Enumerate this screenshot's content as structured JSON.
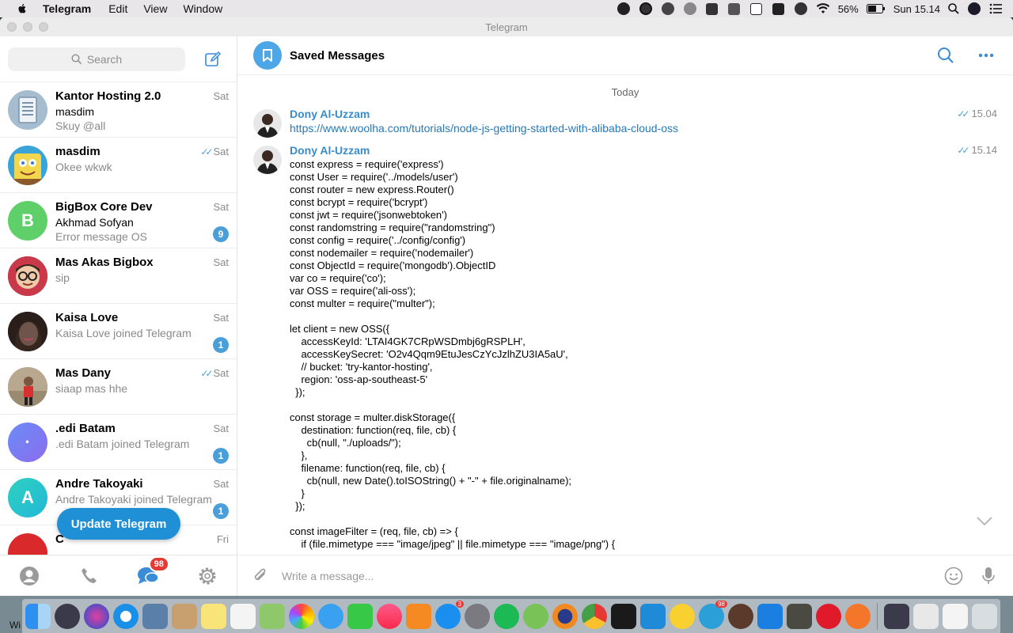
{
  "menubar": {
    "app": "Telegram",
    "items": [
      "Edit",
      "View",
      "Window"
    ],
    "battery": "56%",
    "clock": "Sun 15.14"
  },
  "window": {
    "title": "Telegram"
  },
  "sidebar": {
    "search_placeholder": "Search",
    "chats": [
      {
        "name": "Kantor Hosting 2.0",
        "line2": "masdim",
        "line3": "Skuy @all",
        "time": "Sat",
        "read": false,
        "badge": "",
        "avatar_color": "#9fb9cf",
        "initial": ""
      },
      {
        "name": "masdim",
        "line2": "Okee wkwk",
        "line3": "",
        "time": "Sat",
        "read": true,
        "badge": "",
        "avatar_color": "#f2c94c",
        "initial": ""
      },
      {
        "name": "BigBox Core Dev",
        "line2": "Akhmad Sofyan",
        "line3": "Error message OS",
        "time": "Sat",
        "read": false,
        "badge": "9",
        "avatar_color": "#5fcf6a",
        "initial": "B"
      },
      {
        "name": "Mas Akas Bigbox",
        "line2": "sip",
        "line3": "",
        "time": "Sat",
        "read": false,
        "badge": "",
        "avatar_color": "#c0392b",
        "initial": ""
      },
      {
        "name": "Kaisa Love",
        "line2": "Kaisa Love joined Telegram",
        "line3": "",
        "time": "Sat",
        "read": false,
        "badge": "1",
        "avatar_color": "#6b4b3e",
        "initial": ""
      },
      {
        "name": "Mas Dany",
        "line2": "siaap mas hhe",
        "line3": "",
        "time": "Sat",
        "read": true,
        "badge": "",
        "avatar_color": "#8a7a66",
        "initial": ""
      },
      {
        "name": ".edi Batam",
        "line2": ".edi Batam joined Telegram",
        "line3": "",
        "time": "Sat",
        "read": false,
        "badge": "1",
        "avatar_color": "#7b7df0",
        "initial": "·"
      },
      {
        "name": "Andre Takoyaki",
        "line2": "Andre Takoyaki joined Telegram",
        "line3": "",
        "time": "Sat",
        "read": false,
        "badge": "1",
        "avatar_color": "#2ed1c0",
        "initial": "A"
      },
      {
        "name": "C",
        "line2": "",
        "line3": "",
        "time": "Fri",
        "read": false,
        "badge": "",
        "avatar_color": "#d9292b",
        "initial": ""
      }
    ],
    "update_button": "Update Telegram",
    "tab_badge": "98"
  },
  "main": {
    "title": "Saved Messages",
    "day": "Today",
    "messages": [
      {
        "author": "Dony Al-Uzzam",
        "time": "15.04",
        "link": "https://www.woolha.com/tutorials/node-js-getting-started-with-alibaba-cloud-oss"
      },
      {
        "author": "Dony Al-Uzzam",
        "time": "15.14",
        "code": "const express = require('express')\nconst User = require('../models/user')\nconst router = new express.Router()\nconst bcrypt = require('bcrypt')\nconst jwt = require('jsonwebtoken')\nconst randomstring = require(\"randomstring\")\nconst config = require('../config/config')\nconst nodemailer = require('nodemailer')\nconst ObjectId = require('mongodb').ObjectID\nvar co = require('co');\nvar OSS = require('ali-oss');\nconst multer = require(\"multer\");\n\nlet client = new OSS({\n    accessKeyId: 'LTAI4GK7CRpWSDmbj6gRSPLH',\n    accessKeySecret: 'O2v4Qqm9EtuJesCzYcJzlhZU3IA5aU',\n    // bucket: 'try-kantor-hosting',\n    region: 'oss-ap-southeast-5'\n  });\n\nconst storage = multer.diskStorage({\n    destination: function(req, file, cb) {\n      cb(null, \"./uploads/\");\n    },\n    filename: function(req, file, cb) {\n      cb(null, new Date().toISOString() + \"-\" + file.originalname);\n    }\n  });\n\nconst imageFilter = (req, file, cb) => {\n    if (file.mimetype === \"image/jpeg\" || file.mimetype === \"image/png\") {"
      }
    ],
    "composer_placeholder": "Write a message..."
  },
  "dock": {
    "telegram_badge": "98",
    "appstore_badge": "3",
    "label": "Wi"
  }
}
